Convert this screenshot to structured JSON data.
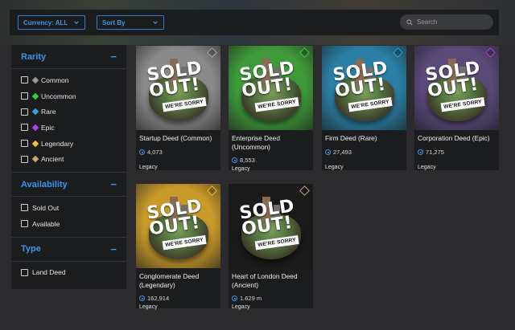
{
  "topbar": {
    "currency_label": "Currency: ALL",
    "sort_label": "Sort By",
    "search_placeholder": "Search"
  },
  "sidebar": {
    "rarity": {
      "title": "Rarity",
      "collapse": "−",
      "options": [
        {
          "label": "Common",
          "color": "#9a9a9a"
        },
        {
          "label": "Uncommon",
          "color": "#35d04a"
        },
        {
          "label": "Rare",
          "color": "#2ea6e6"
        },
        {
          "label": "Epic",
          "color": "#b23ff0"
        },
        {
          "label": "Legendary",
          "color": "#f0c030"
        },
        {
          "label": "Ancient",
          "color": "#c8a86a"
        }
      ]
    },
    "availability": {
      "title": "Availability",
      "collapse": "−",
      "options": [
        {
          "label": "Sold Out"
        },
        {
          "label": "Available"
        }
      ]
    },
    "type": {
      "title": "Type",
      "collapse": "−",
      "options": [
        {
          "label": "Land Deed"
        }
      ]
    }
  },
  "overlay": {
    "sold_line1": "SOLD",
    "sold_line2": "OUT!",
    "sorry": "WE'RE SORRY"
  },
  "cards": [
    {
      "name": "Startup Deed (Common)",
      "price": "4,073",
      "tag": "Legacy",
      "bg": "#8a8a8a",
      "gem": "#aaaaaa"
    },
    {
      "name": "Enterprise Deed (Uncommon)",
      "price": "8,553",
      "tag": "Legacy",
      "bg": "#3f9a3a",
      "gem": "#35d04a"
    },
    {
      "name": "Firm Deed (Rare)",
      "price": "27,493",
      "tag": "Legacy",
      "bg": "#2a7fa6",
      "gem": "#2ea6e6"
    },
    {
      "name": "Corporation Deed (Epic)",
      "price": "71,275",
      "tag": "Legacy",
      "bg": "#5a4a7a",
      "gem": "#b23ff0"
    },
    {
      "name": "Conglomerate Deed (Legendary)",
      "price": "162,914",
      "tag": "Legacy",
      "bg": "#c89a2a",
      "gem": "#f0c030"
    },
    {
      "name": "Heart of London Deed (Ancient)",
      "price": "1.629 m",
      "tag": "Legacy",
      "bg": "#1a1a1a",
      "gem": "#c8a86a"
    }
  ]
}
